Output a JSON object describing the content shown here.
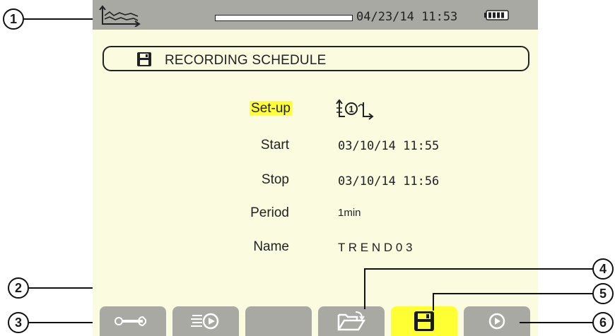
{
  "statusbar": {
    "datetime": "04/23/14 11:53",
    "mode_icon": "trend-recording-icon",
    "battery_icon": "battery-full-icon"
  },
  "header": {
    "title": "RECORDING SCHEDULE",
    "icon": "floppy-disk-icon"
  },
  "form": {
    "setup_label": "Set-up",
    "setup_value_icon": "config-1-icon",
    "start_label": "Start",
    "start_value": "03/10/14 11:55",
    "stop_label": "Stop",
    "stop_value": "03/10/14 11:56",
    "period_label": "Period",
    "period_value": "1min",
    "name_label": "Name",
    "name_value": "T R E N D 0 3"
  },
  "tabs": [
    {
      "icon": "wrench-icon",
      "active": false
    },
    {
      "icon": "list-play-icon",
      "active": false
    },
    {
      "icon": "",
      "active": false
    },
    {
      "icon": "open-folder-icon",
      "active": false
    },
    {
      "icon": "floppy-disk-icon",
      "active": true
    },
    {
      "icon": "play-icon",
      "active": false
    }
  ],
  "callouts": [
    "1",
    "2",
    "3",
    "4",
    "5",
    "6"
  ],
  "colors": {
    "screen_bg": "#fbfbe0",
    "bar_grey": "#a9a9a4",
    "highlight": "#ffff33"
  }
}
